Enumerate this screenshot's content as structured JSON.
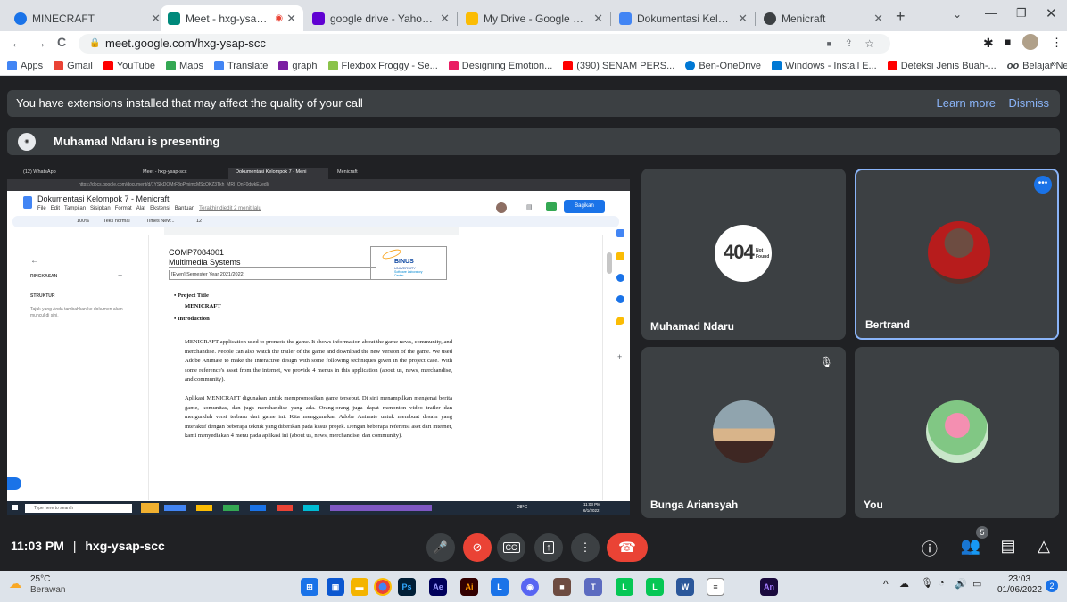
{
  "browser": {
    "tabs": [
      {
        "label": "MINECRAFT",
        "color": "#1a73e8"
      },
      {
        "label": "Meet - hxg-ysap-scc",
        "color": "#00897b"
      },
      {
        "label": "google drive - Yahoo Search",
        "color": "#6001d2"
      },
      {
        "label": "My Drive - Google Drive",
        "color": "#fbbc04"
      },
      {
        "label": "Dokumentasi Kelompok 7 -",
        "color": "#4285f4"
      },
      {
        "label": "Menicraft",
        "color": "#3c4043"
      }
    ],
    "url": "meet.google.com/hxg-ysap-scc",
    "bookmarks": [
      {
        "label": "Apps",
        "color": "#4285f4"
      },
      {
        "label": "Gmail",
        "color": "#ea4335"
      },
      {
        "label": "YouTube",
        "color": "#ff0000"
      },
      {
        "label": "Maps",
        "color": "#34a853"
      },
      {
        "label": "Translate",
        "color": "#4285f4"
      },
      {
        "label": "graph",
        "color": "#7b1fa2"
      },
      {
        "label": "Flexbox Froggy - Se...",
        "color": "#8bc34a"
      },
      {
        "label": "Designing Emotion...",
        "color": "#e91e63"
      },
      {
        "label": "(390) SENAM PERS...",
        "color": "#ff0000"
      },
      {
        "label": "Ben-OneDrive",
        "color": "#0078d4"
      },
      {
        "label": "Windows - Install E...",
        "color": "#0078d4"
      },
      {
        "label": "Deteksi Jenis Buah-...",
        "color": "#ff0000"
      },
      {
        "label": "Belajar Neural Netw...",
        "color": "#333333"
      }
    ]
  },
  "meet": {
    "banner_text": "You have extensions installed that may affect the quality of your call",
    "learn_more": "Learn more",
    "dismiss": "Dismiss",
    "presenting": "Muhamad Ndaru is presenting",
    "participants": [
      {
        "name": "Muhamad Ndaru"
      },
      {
        "name": "Bertrand"
      },
      {
        "name": "Bunga Ariansyah"
      },
      {
        "name": "You"
      }
    ],
    "time": "11:03 PM",
    "separator": "|",
    "code": "hxg-ysap-scc",
    "people_count": "5"
  },
  "shared": {
    "tabs": [
      "(12) WhatsApp",
      "Meet - hxg-ysap-scc",
      "Dokumentasi Kelompok 7 - Meni",
      "Menicraft"
    ],
    "url": "https://docs.google.com/document/d/1YSlkDQMrF8pPmjmcMScQKZ3Tkh_MRl_QnF0dwkEJedI/",
    "doc_title": "Dokumentasi Kelompok 7 - Menicraft",
    "menu": [
      "File",
      "Edit",
      "Tampilan",
      "Sisipkan",
      "Format",
      "Alat",
      "Ekstensi",
      "Bantuan"
    ],
    "last_edit": "Terakhir diedit 2 menit lalu",
    "share": "Bagikan",
    "toolbar_zoom": "100%",
    "toolbar_style": "Teks normal",
    "toolbar_font": "Times New...",
    "toolbar_size": "12",
    "sidebar_ringkasan": "RINGKASAN",
    "sidebar_struktur": "STRUKTUR",
    "sidebar_hint": "Tajuk yang Anda tambahkan ke dokumen akan muncul di sini.",
    "course_code": "COMP7084001",
    "course_name": "Multimedia Systems",
    "semester": "[Even] Semester Year 2021/2022",
    "binus_1": "BINUS",
    "binus_2": "UNIVERSITY",
    "binus_3": "Software Laboratory",
    "binus_4": "Center",
    "bullet1": "Project Title",
    "project_name": "MENICRAFT",
    "bullet2": "Introduction",
    "para_en": "MENICRAFT application used to promote the game. It shows information about the game news, community, and merchandise. People can also watch the trailer of the game and download the new version of the game. We used Adobe Animate to make the interactive design with some following techniques given in the project case. With some reference's asset from the internet, we provide 4 menus in this application (about us, news, merchandise, and community).",
    "para_id": "Aplikasi MENICRAFT digunakan untuk mempromosikan game tersebut. Di sini menampilkan mengenai berita game, komunitas, dan juga merchandise yang ada. Orang-orang juga dapat menonton video trailer dan mengunduh versi terbaru dari game ini. Kita menggunakan Adobe Animate untuk membuat desain yang interaktif dengan beberapa teknik yang diberikan pada kasus projek. Dengan beberapa referensi aset dari internet, kami menyediakan 4 menu pada aplikasi ini (about us, news, merchandise, dan community).",
    "search": "Type here to search",
    "weather": "28°C",
    "clock_time": "11:03 PM",
    "clock_date": "6/1/2022"
  },
  "notfound": {
    "big": "404",
    "line1": "Not",
    "line2": "Found"
  },
  "taskbar": {
    "weather_temp": "25°C",
    "weather_desc": "Berawan",
    "time": "23:03",
    "date": "01/06/2022",
    "notif": "2"
  }
}
